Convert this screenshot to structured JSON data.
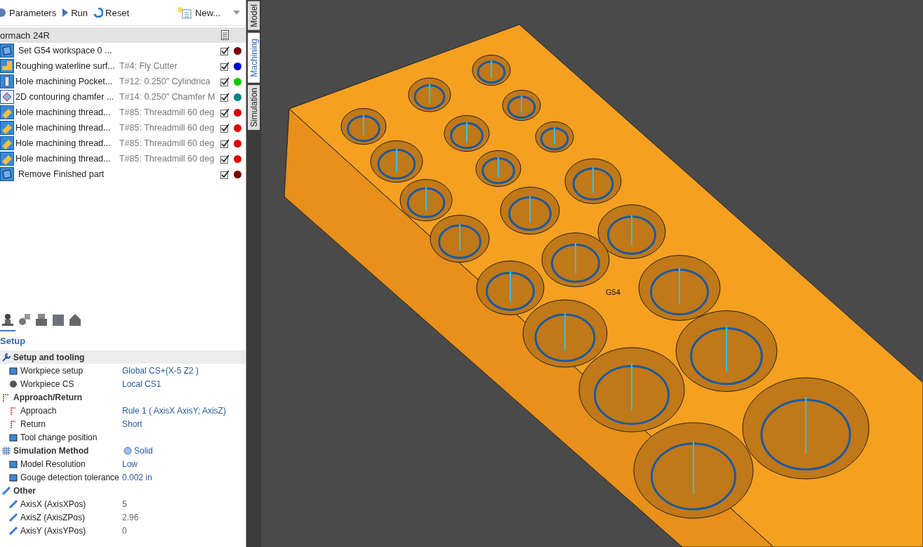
{
  "toolbar": {
    "buttons": [
      {
        "kind": "parameters",
        "label": "Parameters"
      },
      {
        "kind": "run",
        "label": "Run"
      },
      {
        "kind": "reset",
        "label": "Reset"
      },
      {
        "kind": "new",
        "label": "New..."
      }
    ]
  },
  "project": {
    "name": "ormach 24R"
  },
  "operations": [
    {
      "kind": "setup",
      "name": "Set G54 workspace 0 ...",
      "checked": true,
      "color": "#7a0000"
    },
    {
      "kind": "roughing",
      "name": "Roughing waterline surf...",
      "tool": "T#4: Fly Cutter",
      "checked": true,
      "color": "#0000dd"
    },
    {
      "kind": "hole",
      "name": "Hole machining Pocket...",
      "tool": "T#12: 0.250\" Cylindrica",
      "checked": true,
      "color": "#00cc00"
    },
    {
      "kind": "contour",
      "name": "2D contouring chamfer ...",
      "tool": "T#14: 0.250\" Chamfer M",
      "checked": true,
      "color": "#008080"
    },
    {
      "kind": "thread",
      "name": "Hole machining thread...",
      "tool": "T#85: Threadmill 60 deg",
      "checked": true,
      "color": "#e00000"
    },
    {
      "kind": "thread",
      "name": "Hole machining thread...",
      "tool": "T#85: Threadmill 60 deg",
      "checked": true,
      "color": "#e00000"
    },
    {
      "kind": "thread",
      "name": "Hole machining thread...",
      "tool": "T#85: Threadmill 60 deg",
      "checked": true,
      "color": "#e00000"
    },
    {
      "kind": "thread",
      "name": "Hole machining thread...",
      "tool": "T#85: Threadmill 60 deg",
      "checked": true,
      "color": "#e00000"
    },
    {
      "kind": "setup",
      "name": "Remove Finished part",
      "checked": true,
      "color": "#7a0000"
    }
  ],
  "view_tabs": [
    {
      "kind": "machine",
      "selected": true
    },
    {
      "kind": "transform",
      "selected": false
    },
    {
      "kind": "fixture",
      "selected": false
    },
    {
      "kind": "stock",
      "selected": false
    },
    {
      "kind": "house",
      "selected": false
    }
  ],
  "properties": {
    "title": "Setup",
    "groups": [
      {
        "label": "Setup and tooling",
        "kind": "wrench",
        "rows": [
          {
            "label": "Workpiece setup",
            "value": "Global CS+(X-5 Z2 )",
            "kind": "workpiece",
            "editable": true
          },
          {
            "label": "Workpiece CS",
            "value": "Local CS1",
            "kind": "globe",
            "editable": true
          }
        ]
      },
      {
        "label": "Approach/Return",
        "kind": "approach",
        "rows": [
          {
            "label": "Approach",
            "value": "Rule 1 ( AxisX AxisY; AxisZ)",
            "kind": "approach",
            "editable": true
          },
          {
            "label": "Return",
            "value": "Short",
            "kind": "approach",
            "editable": true
          },
          {
            "label": "Tool change position",
            "kind": "workpiece"
          }
        ]
      },
      {
        "label": "Simulation Method",
        "kind": "grid",
        "value": "Solid",
        "rows": [
          {
            "label": "Model Resolution",
            "value": "Low",
            "kind": "workpiece",
            "editable": true
          },
          {
            "label": "Gouge detection tolerance",
            "value": "0.002 in",
            "kind": "workpiece",
            "editable": true
          }
        ]
      },
      {
        "label": "Other",
        "kind": "axis",
        "rows": [
          {
            "label": "AxisX (AxisXPos)",
            "value": "5",
            "kind": "axis",
            "editable": false
          },
          {
            "label": "AxisZ (AxisZPos)",
            "value": "2.96",
            "kind": "axis",
            "editable": false
          },
          {
            "label": "AxisY (AxisYPos)",
            "value": "0",
            "kind": "axis",
            "editable": false
          }
        ]
      }
    ]
  },
  "side_tabs": [
    {
      "label": "Model",
      "selected": false
    },
    {
      "label": "Machining",
      "selected": true
    },
    {
      "label": "Simulation",
      "selected": false
    }
  ],
  "viewport": {
    "origin_label": "G54"
  }
}
